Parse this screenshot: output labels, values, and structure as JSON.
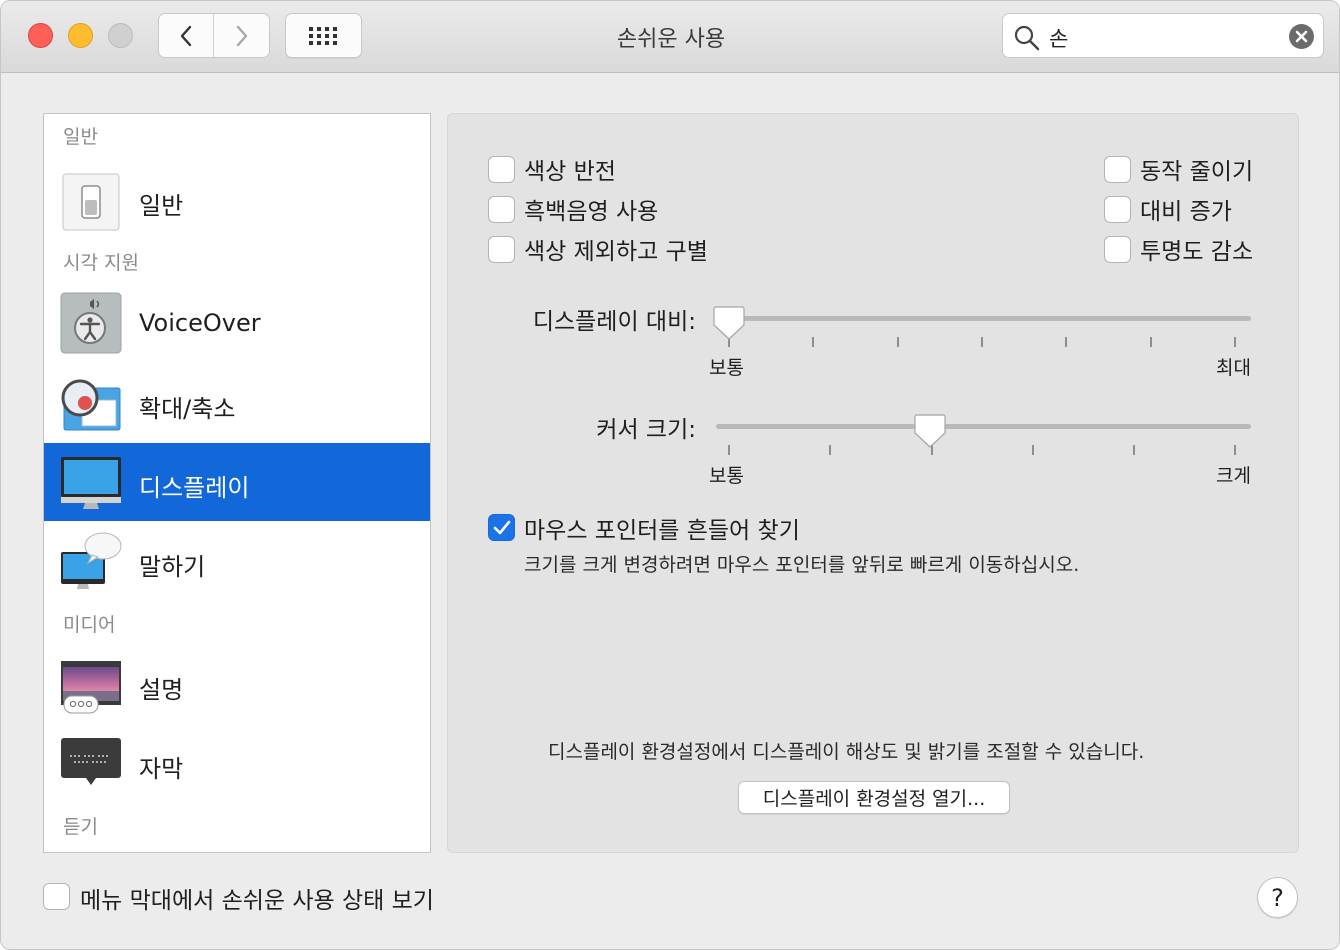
{
  "window": {
    "title": "손쉬운 사용"
  },
  "search": {
    "query": "손"
  },
  "sidebar": {
    "sections": {
      "general": "일반",
      "vision": "시각 지원",
      "media": "미디어",
      "hearing": "듣기"
    },
    "items": [
      {
        "label": "일반",
        "icon": "general-switch-icon"
      },
      {
        "label": "VoiceOver",
        "icon": "voiceover-icon"
      },
      {
        "label": "확대/축소",
        "icon": "zoom-icon"
      },
      {
        "label": "디스플레이",
        "icon": "display-icon",
        "selected": true
      },
      {
        "label": "말하기",
        "icon": "speech-icon"
      },
      {
        "label": "설명",
        "icon": "descriptions-icon"
      },
      {
        "label": "자막",
        "icon": "captions-icon"
      }
    ]
  },
  "display": {
    "checkboxes_left": [
      {
        "label": "색상 반전",
        "checked": false
      },
      {
        "label": "흑백음영 사용",
        "checked": false
      },
      {
        "label": "색상 제외하고 구별",
        "checked": false
      }
    ],
    "checkboxes_right": [
      {
        "label": "동작 줄이기",
        "checked": false
      },
      {
        "label": "대비 증가",
        "checked": false
      },
      {
        "label": "투명도 감소",
        "checked": false
      }
    ],
    "contrast_slider": {
      "label": "디스플레이 대비:",
      "min_label": "보통",
      "max_label": "최대",
      "value": 0
    },
    "cursor_slider": {
      "label": "커서 크기:",
      "min_label": "보통",
      "max_label": "크게",
      "value": 0.4
    },
    "shake_to_locate": {
      "label": "마우스 포인터를 흔들어 찾기",
      "checked": true,
      "description": "크기를 크게 변경하려면 마우스 포인터를 앞뒤로 빠르게 이동하십시오."
    },
    "prefs_note": "디스플레이 환경설정에서 디스플레이 해상도 및 밝기를 조절할 수 있습니다.",
    "open_prefs_button": "디스플레이 환경설정 열기..."
  },
  "footer": {
    "menubar_status_label": "메뉴 막대에서 손쉬운 사용 상태 보기",
    "menubar_status_checked": false,
    "help_label": "?"
  },
  "colors": {
    "accent": "#1268d9",
    "close": "#fe5f57",
    "minimize": "#febc2e"
  }
}
